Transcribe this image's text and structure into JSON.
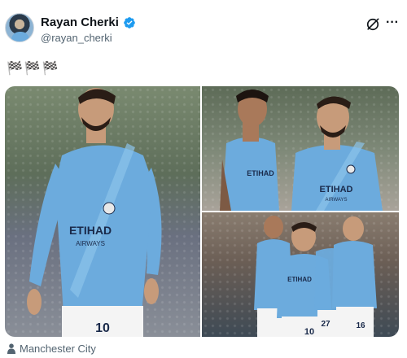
{
  "user": {
    "display_name": "Rayan Cherki",
    "handle": "@rayan_cherki"
  },
  "tweet": {
    "text": "🏁🏁🏁"
  },
  "media": {
    "photos": [
      {
        "shirt_sponsor": "ETIHAD",
        "shirt_sponsor_sub": "AIRWAYS",
        "shorts_number": "10"
      },
      {
        "shirt_sponsor": "ETIHAD",
        "shirt_sponsor_sub": "AIRWAYS",
        "shirt_sponsor_2": "ETIHAD"
      },
      {
        "shirt_sponsor": "ETIHAD",
        "shorts_numbers": [
          "10",
          "27",
          "16"
        ]
      }
    ]
  },
  "location": {
    "label": "Manchester City"
  },
  "colors": {
    "verified": "#1d9bf0",
    "kit_blue": "#6cabdd",
    "secondary_text": "#536471"
  },
  "icons": [
    "verified-badge-icon",
    "grok-icon",
    "more-icon",
    "person-icon"
  ]
}
